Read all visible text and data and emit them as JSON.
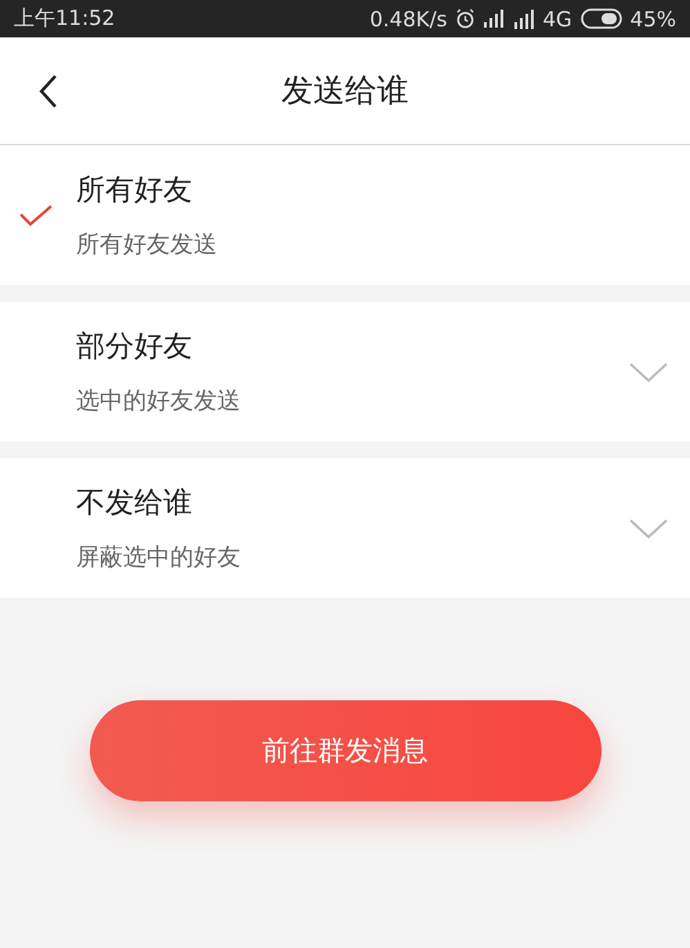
{
  "status_bar": {
    "time": "上午11:52",
    "speed": "0.48K/s",
    "network": "4G",
    "battery": "45%"
  },
  "header": {
    "title": "发送给谁"
  },
  "options": [
    {
      "title": "所有好友",
      "subtitle": "所有好友发送",
      "selected": true,
      "kind": "plain"
    },
    {
      "title": "部分好友",
      "subtitle": "选中的好友发送",
      "selected": false,
      "kind": "expandable"
    },
    {
      "title": "不发给谁",
      "subtitle": "屏蔽选中的好友",
      "selected": false,
      "kind": "expandable"
    }
  ],
  "action_button": {
    "label": "前往群发消息"
  }
}
